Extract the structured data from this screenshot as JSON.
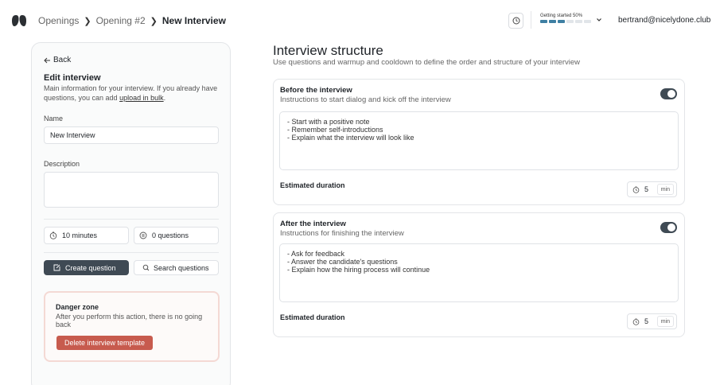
{
  "header": {
    "breadcrumbs": [
      "Openings",
      "Opening #2",
      "New Interview"
    ],
    "progress": {
      "label": "Getting started 50%",
      "value": 0.5,
      "segments_total": 6,
      "segments_done": 3
    },
    "user_email": "bertrand@nicelydone.club"
  },
  "sidebar": {
    "back_label": "Back",
    "title": "Edit interview",
    "description": "Main information for your interview. If you already have questions, you can add",
    "description_link": "upload in bulk",
    "description_end": ".",
    "name_label": "Name",
    "name_value": "New Interview",
    "description_label": "Description",
    "description_value": "",
    "duration_stat": "10 minutes",
    "questions_stat": "0 questions",
    "create_question_label": "Create question",
    "search_questions_label": "Search questions",
    "danger": {
      "title": "Danger zone",
      "text": "After you perform this action, there is no going back",
      "button_label": "Delete interview template"
    }
  },
  "main": {
    "title": "Interview structure",
    "subtitle": "Use questions and warmup and cooldown to define the order and structure of your interview",
    "sections": [
      {
        "title": "Before the interview",
        "subtitle": "Instructions to start dialog and kick off the interview",
        "enabled": true,
        "instructions": "- Start with a positive note\n- Remember self-introductions\n- Explain what the interview will look like",
        "duration_label": "Estimated duration",
        "duration_value": "5",
        "duration_unit": "min"
      },
      {
        "title": "After the interview",
        "subtitle": "Instructions for finishing the interview",
        "enabled": true,
        "instructions": "- Ask for feedback\n- Answer the candidate's questions\n- Explain how the hiring process will continue",
        "duration_label": "Estimated duration",
        "duration_value": "5",
        "duration_unit": "min"
      }
    ]
  },
  "colors": {
    "primary_dark": "#3f4a54",
    "danger": "#c75b4e",
    "progress": "#3e7fa3"
  }
}
